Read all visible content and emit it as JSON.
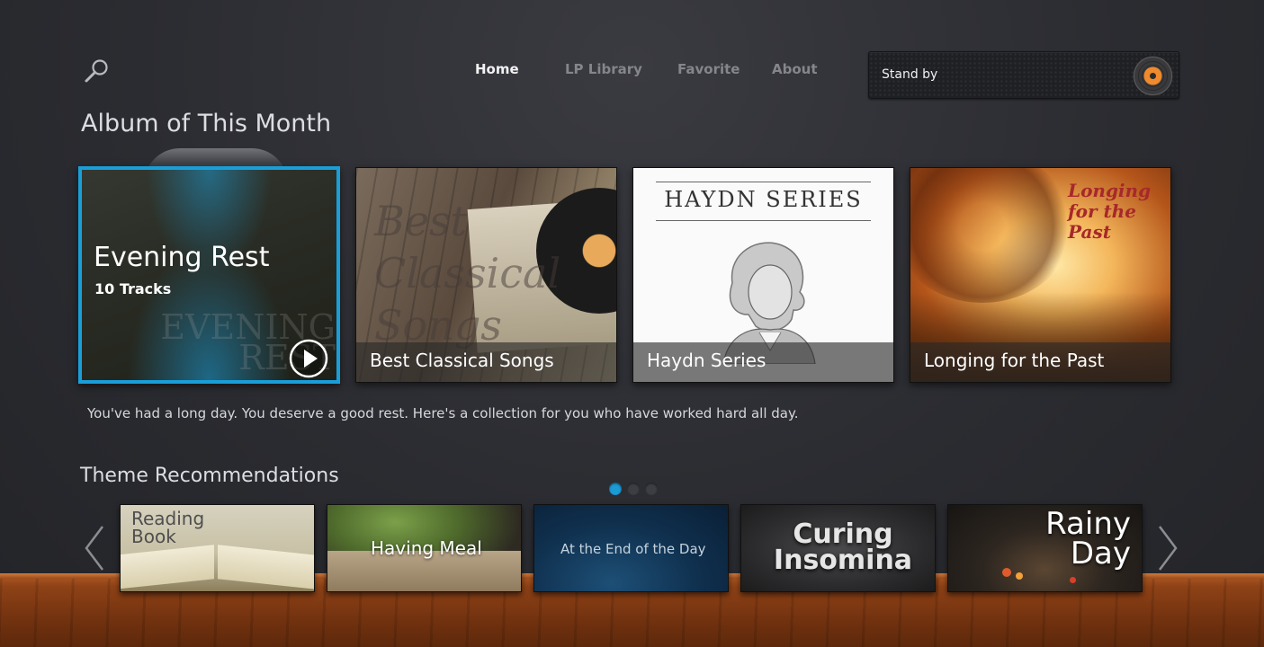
{
  "header": {
    "search_icon": "search-icon",
    "nav": [
      {
        "label": "Home",
        "active": true
      },
      {
        "label": "LP Library",
        "active": false
      },
      {
        "label": "Favorite",
        "active": false
      },
      {
        "label": "About",
        "active": false
      }
    ],
    "player": {
      "status": "Stand by",
      "disc_icon": "vinyl-disc-icon"
    }
  },
  "album_section": {
    "title": "Album of This Month",
    "featured": {
      "title": "Evening Rest",
      "tracks": "10 Tracks",
      "play_icon": "play-icon"
    },
    "albums": [
      {
        "caption": "Best Classical Songs"
      },
      {
        "caption": "Haydn Series",
        "cover_heading": "HAYDN SERIES"
      },
      {
        "caption": "Longing for the Past",
        "cover_heading": "Longing for the Past"
      }
    ],
    "description": "You've had a long day. You deserve a good rest. Here's a collection for you who have worked hard all day."
  },
  "theme_section": {
    "title": "Theme Recommendations",
    "page_dots": {
      "count": 3,
      "active": 1
    },
    "arrows": {
      "left_icon": "chevron-left-icon",
      "right_icon": "chevron-right-icon"
    },
    "themes": [
      {
        "label": "Reading Book"
      },
      {
        "label": "Having Meal"
      },
      {
        "label": "At the End of the Day"
      },
      {
        "label": "Curing Insomina"
      },
      {
        "label": "Rainy Day"
      }
    ]
  },
  "colors": {
    "accent": "#1a9ed8",
    "player_disc_center": "#f08a2c",
    "shelf_wood": "#8e4216",
    "background": "#2b2c31"
  }
}
